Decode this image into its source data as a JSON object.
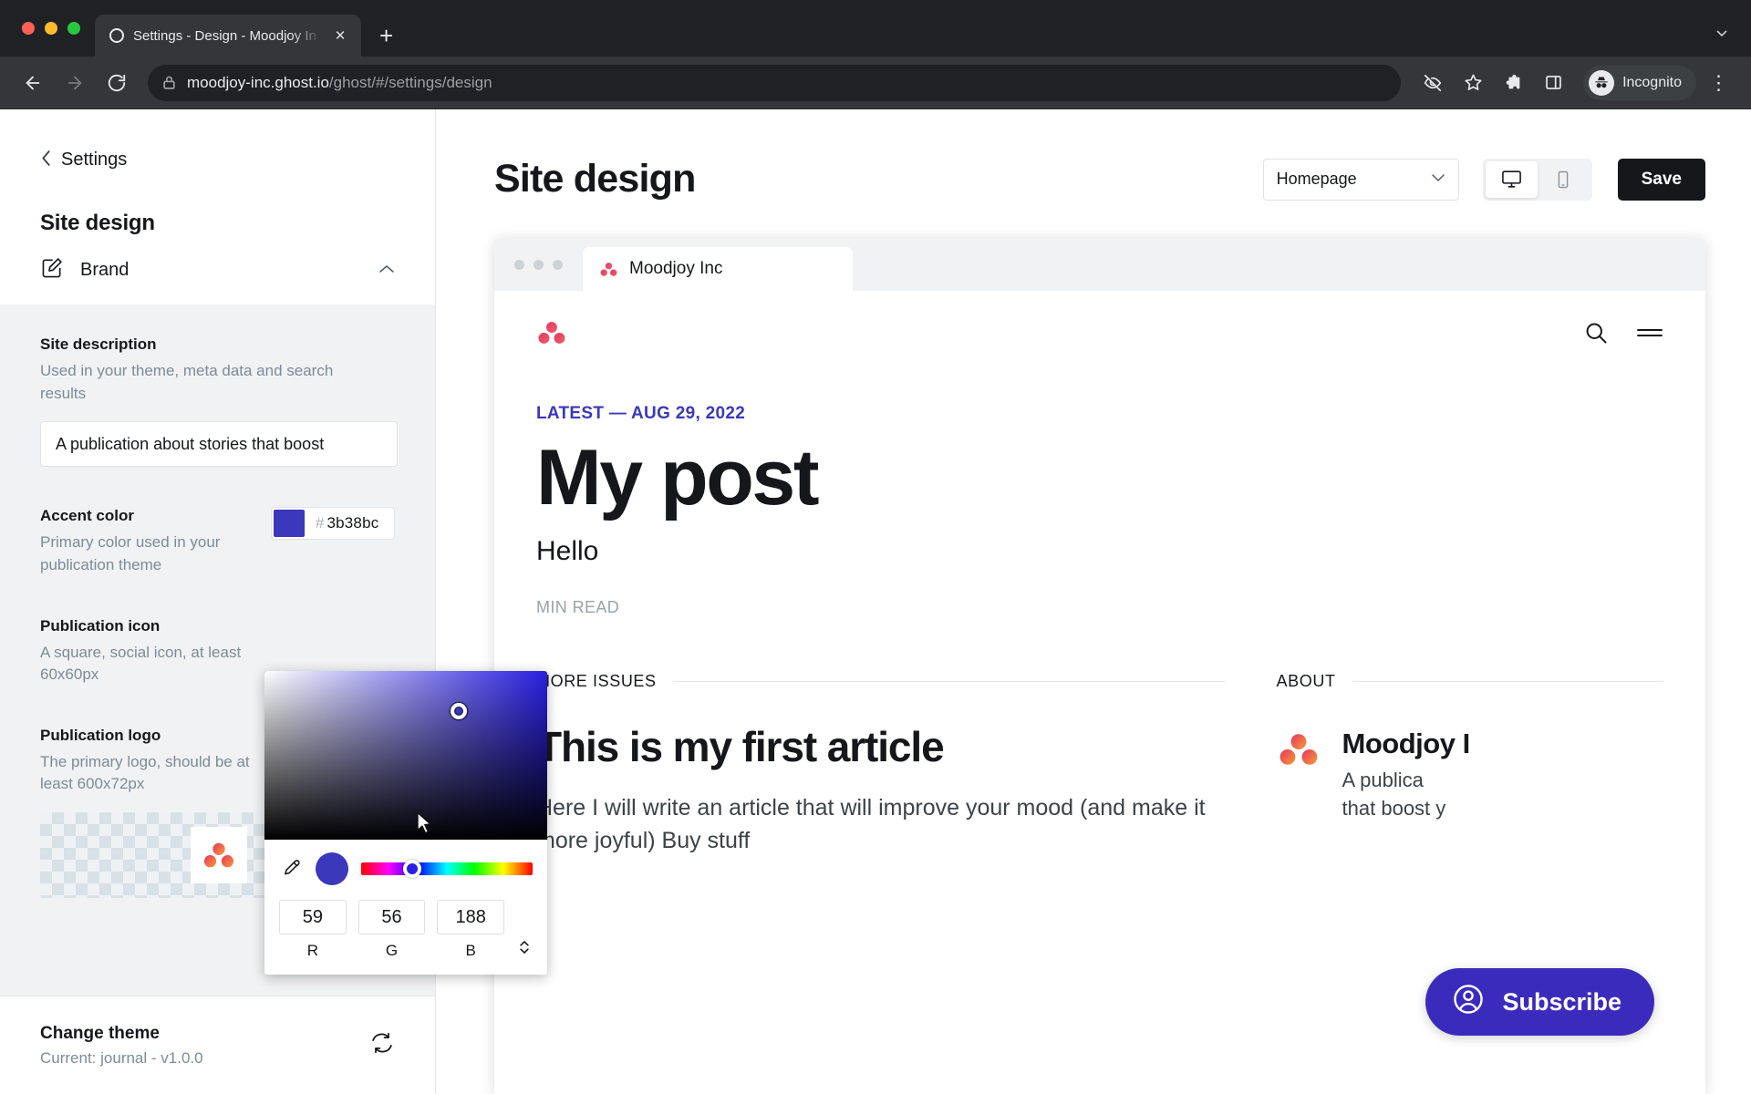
{
  "browser": {
    "tab": {
      "title": "Settings - Design - Moodjoy In",
      "close_label": "×",
      "favicon": "ghost-favicon"
    },
    "new_tab_label": "+",
    "back_label": "←",
    "forward_label": "→",
    "reload_label": "⟳",
    "url_domain": "moodjoy-inc.ghost.io",
    "url_path": "/ghost/#/settings/design",
    "profile_label": "Incognito",
    "icons": [
      "eye-off-icon",
      "star-icon",
      "extensions-icon",
      "side-panel-icon"
    ],
    "menu_label": "⋮"
  },
  "sidebar": {
    "back_label": "Settings",
    "section_title": "Site design",
    "brand": {
      "label": "Brand",
      "icon": "brand-pencil-icon",
      "expanded": true
    },
    "site_description": {
      "label": "Site description",
      "help": "Used in your theme, meta data and search results",
      "value": "A publication about stories that boost"
    },
    "accent_color": {
      "label": "Accent color",
      "help": "Primary color used in your publication theme",
      "hash": "#",
      "hex": "3b38bc",
      "swatch": "#3b38bc"
    },
    "publication_icon": {
      "label": "Publication icon",
      "help": "A square, social icon, at least 60x60px"
    },
    "publication_logo": {
      "label": "Publication logo",
      "help": "The primary logo, should be at least 600x72px"
    },
    "change_theme": {
      "title": "Change theme",
      "subtitle": "Current: journal - v1.0.0",
      "icon": "refresh-icon"
    }
  },
  "color_picker": {
    "eyedropper_icon": "eyedropper-icon",
    "preview_color": "#3b38bc",
    "hue_handle_color": "#2a20e0",
    "channels": [
      {
        "label": "R",
        "value": "59"
      },
      {
        "label": "G",
        "value": "56"
      },
      {
        "label": "B",
        "value": "188"
      }
    ],
    "stepper_icon": "stepper-updown-icon"
  },
  "main": {
    "title": "Site design",
    "page_select": {
      "value": "Homepage",
      "caret": "⌄"
    },
    "devices": [
      {
        "name": "desktop",
        "icon": "desktop-icon",
        "active": true
      },
      {
        "name": "mobile",
        "icon": "mobile-icon",
        "active": false
      }
    ],
    "save_label": "Save"
  },
  "preview": {
    "chrome_tab_title": "Moodjoy Inc",
    "header_icons": [
      "search-icon",
      "hamburger-menu-icon"
    ],
    "latest_label": "LATEST — AUG 29, 2022",
    "post_title": "My post",
    "post_excerpt": "Hello",
    "read_time": "MIN READ",
    "more_issues_label": "MORE ISSUES",
    "article": {
      "title": "This is my first article",
      "body": "Here I will write an article that will improve your mood (and make it more joyful) Buy stuff"
    },
    "about_label": "ABOUT",
    "about": {
      "name": "Moodjoy I",
      "description": "A publica\nthat boost y"
    },
    "subscribe_label": "Subscribe",
    "accent_color": "#3b38bc"
  }
}
